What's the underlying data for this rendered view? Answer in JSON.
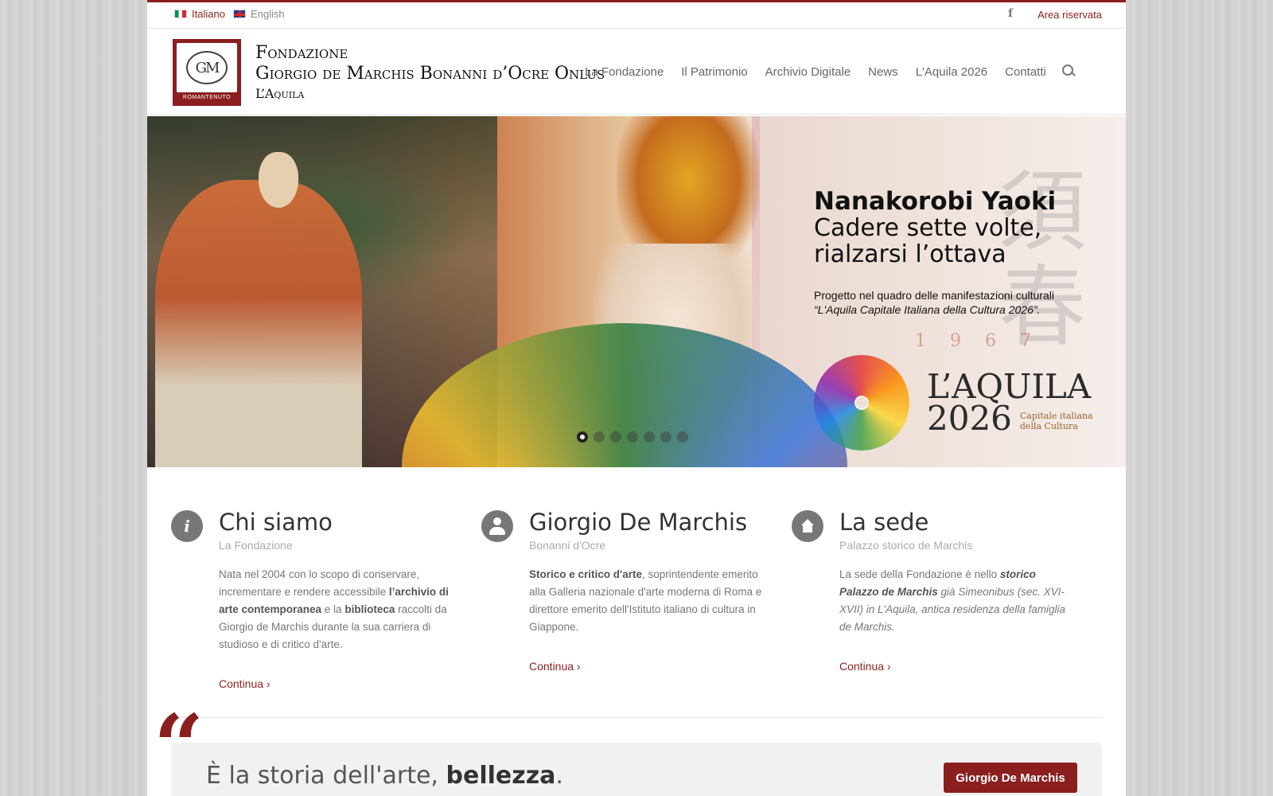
{
  "topbar": {
    "lang_it": "Italiano",
    "lang_en": "English",
    "facebook_icon": "f",
    "reserved": "Area riservata"
  },
  "brand": {
    "logo_mark": "GM",
    "logo_caption": "ROMANTENUTO",
    "line1": "Fondazione",
    "line2": "Giorgio de Marchis Bonanni d’Ocre Onlus",
    "line3": "L’Aquila"
  },
  "nav": {
    "items": [
      "La Fondazione",
      "Il Patrimonio",
      "Archivio Digitale",
      "News",
      "L'Aquila 2026",
      "Contatti"
    ]
  },
  "hero": {
    "title": "Nanakorobi Yaoki",
    "subtitle1": "Cadere sette volte,",
    "subtitle2": "rialzarsi l’ottava",
    "desc1": "Progetto nel quadro delle manifestazioni culturali",
    "desc2": "“L'Aquila Capitale Italiana della Cultura 2026”.",
    "year_digits": [
      "1",
      "9",
      "6",
      "7"
    ],
    "logo_word1": "L’AQUILA",
    "logo_word2": "2026",
    "logo_tag1": "Capitale italiana",
    "logo_tag2": "della Cultura",
    "slides": 7,
    "active_slide": 1
  },
  "columns": [
    {
      "icon": "info-icon",
      "title": "Chi siamo",
      "subtitle": "La Fondazione",
      "p1": "Nata nel 2004 con lo scopo di conservare, incrementare e rendere accessibile ",
      "b1": "l’archivio di arte contemporanea",
      "p2": " e la ",
      "b2": "biblioteca",
      "p3": " raccolti da Giorgio de Marchis durante la sua carriera di studioso e di critico d'arte.",
      "more": "Continua ›"
    },
    {
      "icon": "user-icon",
      "title": "Giorgio De Marchis",
      "subtitle": "Bonanni d'Ocre",
      "b1": "Storico e critico d'arte",
      "p1": ", soprintendente emerito alla Galleria nazionale d'arte moderna di Roma e direttore emerito dell'Istituto italiano di cultura in Giappone.",
      "more": "Continua ›"
    },
    {
      "icon": "home-icon",
      "title": "La sede",
      "subtitle": "Palazzo storico de Marchis",
      "p1": "La sede della Fondazione è nello ",
      "b1": "storico Palazzo de Marchis",
      "p2": " già Simeonibus (sec. XVI-XVII) in L'Aquila, antica residenza della famiglia de Marchis.",
      "more": "Continua ›"
    }
  ],
  "quote": {
    "mark": "“",
    "text": "È la storia dell'arte, ",
    "bold": "bellezza",
    "end": ".",
    "button": "Giorgio De Marchis"
  },
  "colors": {
    "accent": "#8b1f1f"
  }
}
